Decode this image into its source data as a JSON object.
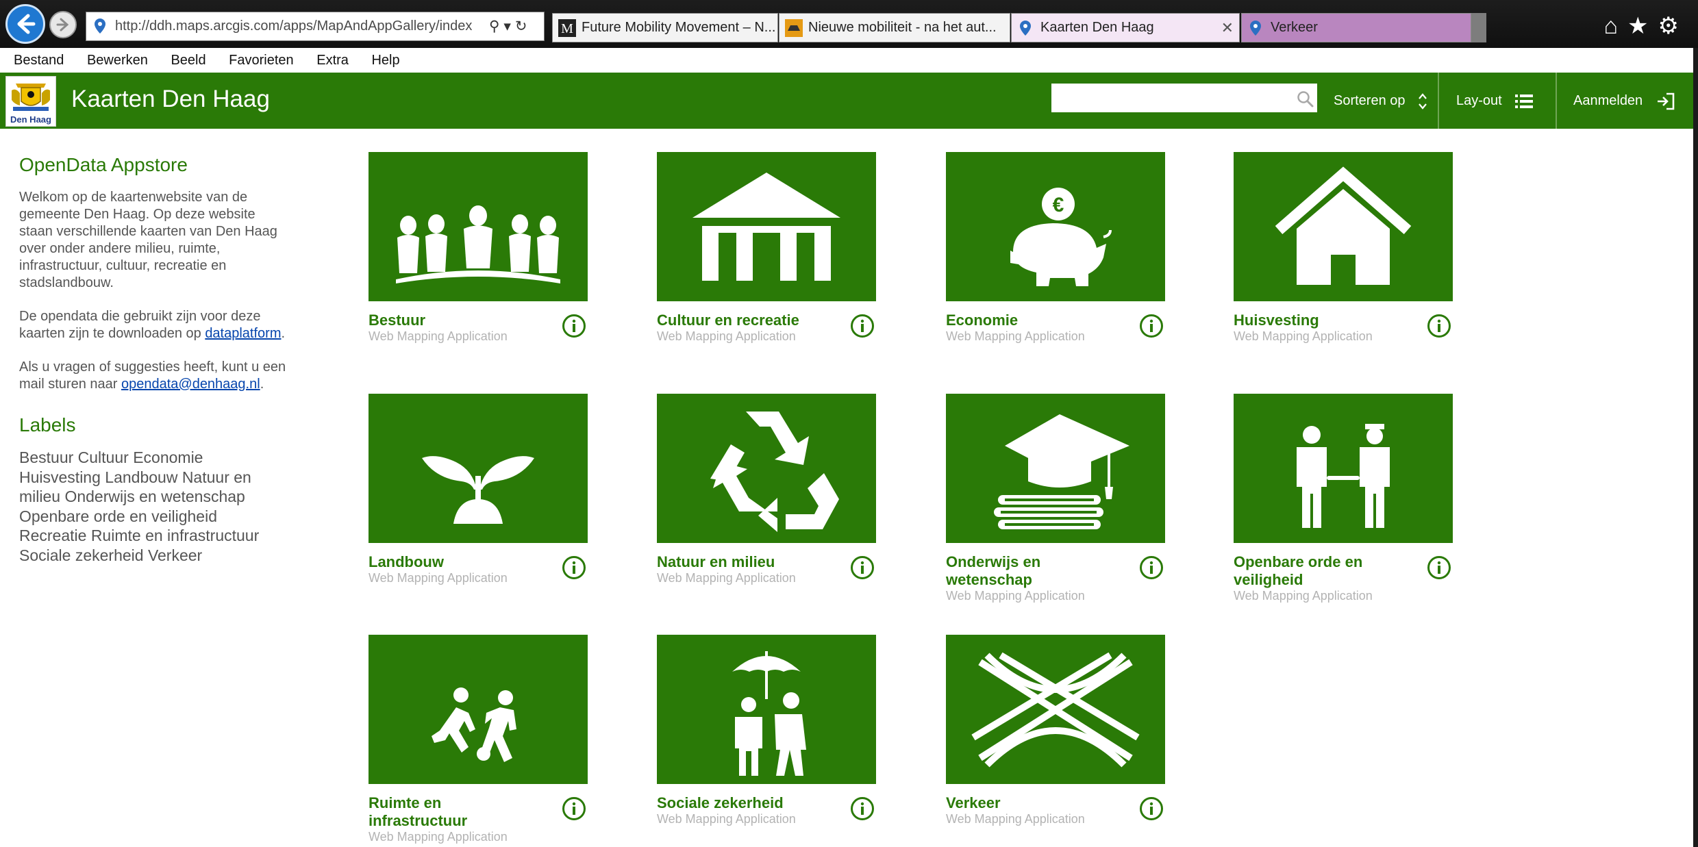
{
  "browser": {
    "url": "http://ddh.maps.arcgis.com/apps/MapAndAppGallery/index",
    "tabs": [
      {
        "label": "Future Mobility Movement – N...",
        "icon": "medium-icon"
      },
      {
        "label": "Nieuwe mobiliteit - na het aut...",
        "icon": "car-icon"
      },
      {
        "label": "Kaarten Den Haag",
        "icon": "map-pin-icon",
        "active": true
      },
      {
        "label": "Verkeer",
        "icon": "map-pin-icon"
      }
    ]
  },
  "menu": [
    "Bestand",
    "Bewerken",
    "Beeld",
    "Favorieten",
    "Extra",
    "Help"
  ],
  "header": {
    "logo_text": "Den Haag",
    "title": "Kaarten Den Haag",
    "search_placeholder": "",
    "sort_label": "Sorteren op",
    "layout_label": "Lay-out",
    "signin_label": "Aanmelden"
  },
  "sidebar": {
    "heading": "OpenData Appstore",
    "intro": "Welkom op de kaartenwebsite van de gemeente Den Haag. Op deze website staan verschillende kaarten van Den Haag over onder andere milieu, ruimte, infrastructuur, cultuur, recreatie en stadslandbouw.",
    "opendata_prefix": "De opendata die gebruikt zijn voor deze kaarten zijn te downloaden op ",
    "opendata_link": "dataplatform",
    "opendata_suffix": ".",
    "contact_prefix": "Als u vragen of suggesties heeft, kunt u een mail sturen naar ",
    "contact_email": "opendata@denhaag.nl",
    "contact_suffix": ".",
    "labels_heading": "Labels",
    "labels": "Bestuur Cultuur Economie Huisvesting Landbouw Natuur en milieu Onderwijs en wetenschap Openbare orde en veiligheid Recreatie Ruimte en infrastructuur Sociale zekerheid Verkeer"
  },
  "colors": {
    "brand_green": "#2a7a07"
  },
  "gallery": {
    "items": [
      {
        "title": "Bestuur",
        "type": "Web Mapping Application",
        "icon": "council-people-icon"
      },
      {
        "title": "Cultuur en recreatie",
        "type": "Web Mapping Application",
        "icon": "museum-icon"
      },
      {
        "title": "Economie",
        "type": "Web Mapping Application",
        "icon": "piggy-bank-icon"
      },
      {
        "title": "Huisvesting",
        "type": "Web Mapping Application",
        "icon": "house-icon"
      },
      {
        "title": "Landbouw",
        "type": "Web Mapping Application",
        "icon": "sprout-icon"
      },
      {
        "title": "Natuur en milieu",
        "type": "Web Mapping Application",
        "icon": "recycle-icon"
      },
      {
        "title": "Onderwijs en wetenschap",
        "type": "Web Mapping Application",
        "icon": "graduation-cap-icon"
      },
      {
        "title": "Openbare orde en veiligheid",
        "type": "Web Mapping Application",
        "icon": "police-arrest-icon"
      },
      {
        "title": "Ruimte en infrastructuur",
        "type": "Web Mapping Application",
        "icon": "football-players-icon"
      },
      {
        "title": "Sociale zekerheid",
        "type": "Web Mapping Application",
        "icon": "umbrella-protection-icon"
      },
      {
        "title": "Verkeer",
        "type": "Web Mapping Application",
        "icon": "highway-interchange-icon"
      }
    ]
  }
}
